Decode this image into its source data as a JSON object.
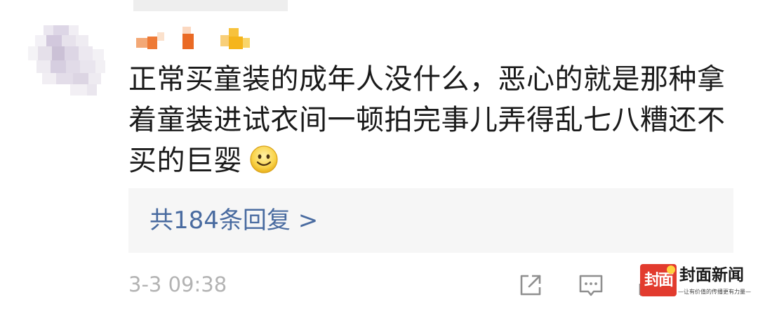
{
  "comment": {
    "lines": [
      "正常买童装的成年人没什么，恶心的就是那种拿",
      "着童装进试衣间一顿拍完事儿弄得乱七八糟还不",
      "买的巨婴"
    ],
    "emoji": "smile-emoji"
  },
  "replies": {
    "label": "共184条回复 >"
  },
  "meta": {
    "timestamp": "3-3 09:38"
  },
  "actions": {
    "icons": [
      "share-icon",
      "comment-icon",
      "like-icon"
    ]
  },
  "watermark": {
    "badge": "封面",
    "name": "封面新闻",
    "slogan": "—让有价值的传播更有力量—"
  },
  "colors": {
    "text": "#1a1a1a",
    "link": "#496ba0",
    "muted": "#b3b3b3",
    "replies_bg": "#f6f6f6",
    "brand_red": "#e23b2e"
  }
}
